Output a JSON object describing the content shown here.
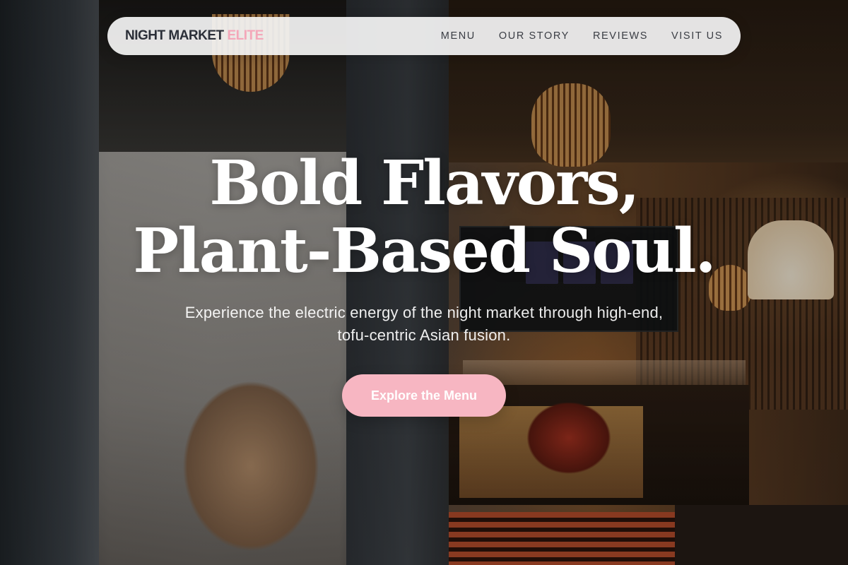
{
  "brand": {
    "name": "NIGHT MARKET",
    "accent": "ELITE"
  },
  "nav": {
    "links": [
      {
        "label": "MENU"
      },
      {
        "label": "OUR STORY"
      },
      {
        "label": "REVIEWS"
      },
      {
        "label": "VISIT US"
      }
    ]
  },
  "hero": {
    "headline_line1": "Bold Flavors,",
    "headline_line2": "Plant-Based Soul.",
    "subtitle": "Experience the electric energy of the night market through high-end, tofu-centric Asian fusion.",
    "cta_label": "Explore the Menu"
  },
  "colors": {
    "accent_pink": "#f7b6c2",
    "brand_text": "#2b2f38",
    "nav_background": "#f5f5f5"
  }
}
